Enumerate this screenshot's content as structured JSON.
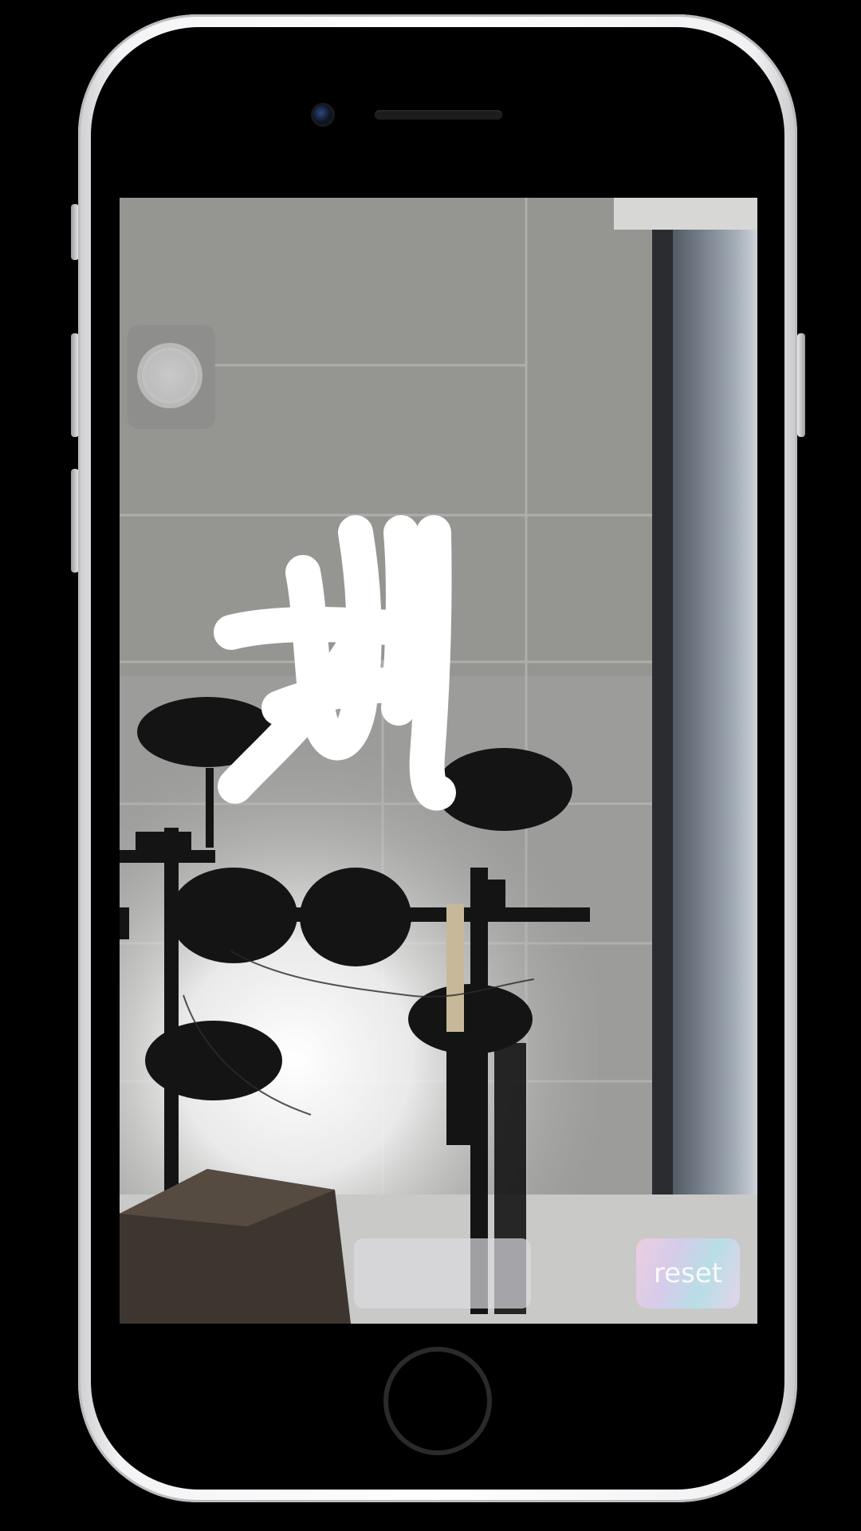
{
  "ar_view": {
    "drawing_strokes": "AI"
  },
  "controls": {
    "reset_label": "reset"
  },
  "colors": {
    "stroke": "#ffffff",
    "reset_gradient_start": "#f0cfe3",
    "reset_gradient_end": "#b7e1ea"
  },
  "icons": {
    "capture": "capture-button-icon",
    "home": "home-button-icon"
  }
}
